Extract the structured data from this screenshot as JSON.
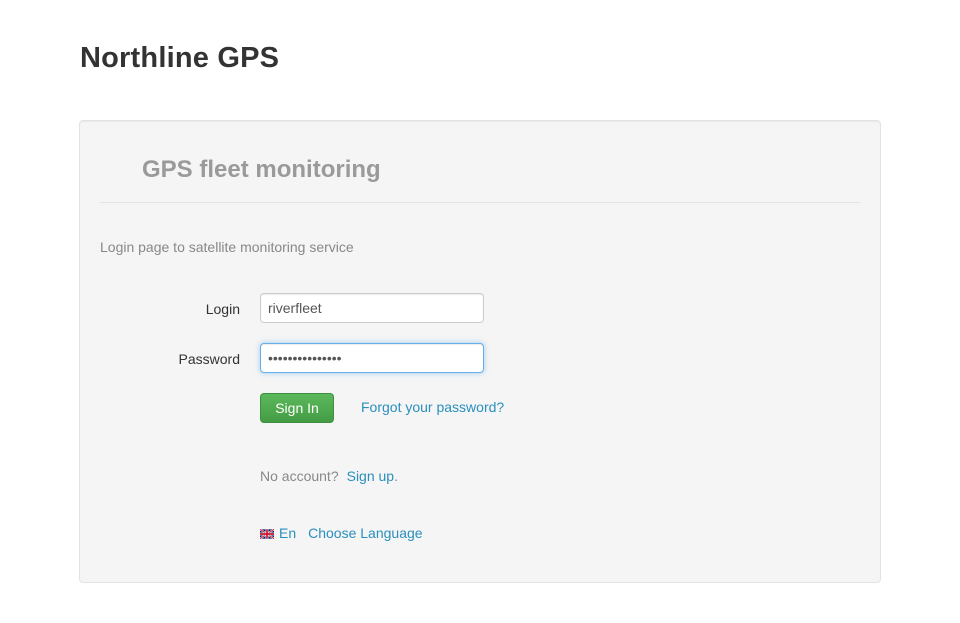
{
  "brand": {
    "title": "Northline GPS"
  },
  "panel": {
    "title": "GPS fleet monitoring",
    "intro": "Login page to satellite monitoring service"
  },
  "form": {
    "login_label": "Login",
    "login_value": "riverfleet",
    "password_label": "Password",
    "password_value": "•••••••••••••••",
    "signin_label": "Sign In",
    "forgot_label": "Forgot your password?",
    "no_account_text": "No account?",
    "signup_label": "Sign up",
    "signup_suffix": "."
  },
  "language": {
    "flag_icon": "uk-flag-icon",
    "code": "En",
    "choose_label": "Choose Language"
  },
  "colors": {
    "accent_link": "#2a8fbd",
    "success_button": "#5cb85c",
    "panel_bg": "#f5f5f5"
  }
}
